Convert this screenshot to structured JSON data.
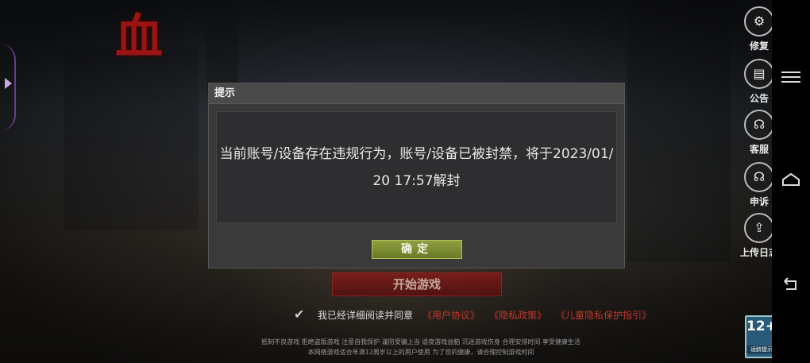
{
  "side_menu": [
    {
      "label": "修复",
      "icon": "repair-gear-icon",
      "glyph": "⚙"
    },
    {
      "label": "公告",
      "icon": "announcement-icon",
      "glyph": "▤"
    },
    {
      "label": "客服",
      "icon": "customer-service-icon",
      "glyph": "☊"
    },
    {
      "label": "申诉",
      "icon": "appeal-icon",
      "glyph": "☊"
    },
    {
      "label": "上传日志",
      "icon": "upload-icon",
      "glyph": "⇪"
    }
  ],
  "start_button": {
    "label": "开始游戏"
  },
  "agreement": {
    "text": "我已经详细阅读并同意",
    "links": [
      "《用户协议》",
      "《隐私政策》",
      "《儿童隐私保护指引》"
    ]
  },
  "health_notice": {
    "line1": "抵制不良游戏  拒绝盗版游戏  注意自我保护  谨防受骗上当  适度游戏益脑  沉迷游戏伤身  合理安排时间  享受健康生活",
    "line2": "本网络游戏适合年满12周岁以上的用户使用    为了您的健康，请合理控制游戏时间"
  },
  "age_rating": {
    "value": "12+",
    "sub": "适龄提示"
  },
  "dialog": {
    "title": "提示",
    "message": "当前账号/设备存在违规行为，账号/设备已被封禁，将于2023/01/20 17:57解封",
    "confirm_label": "确定"
  },
  "colors": {
    "confirm_button": "#7e8f33",
    "dialog_bg": "#3a3a3b",
    "link_red": "#c0392b"
  }
}
